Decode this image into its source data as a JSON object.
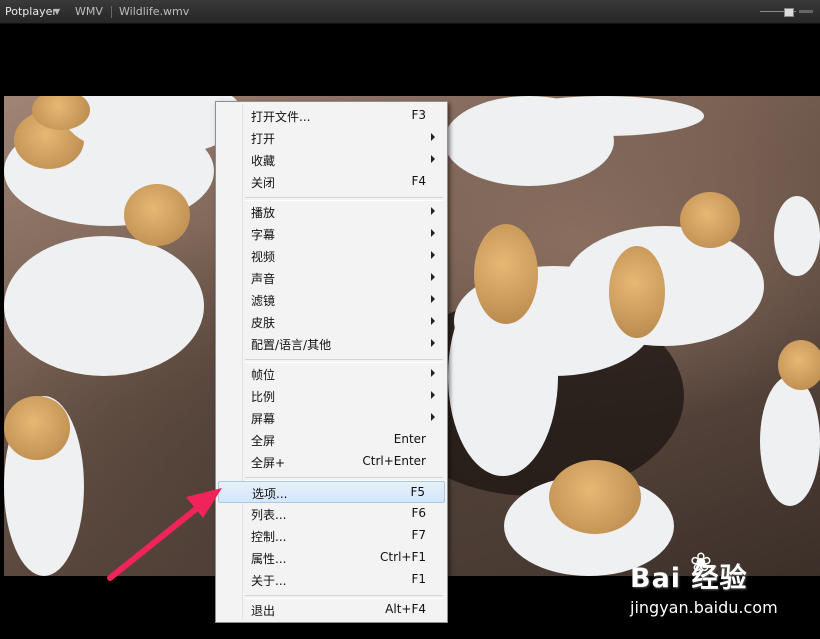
{
  "titlebar": {
    "app_label": "Potplayer",
    "format": "WMV",
    "filename": "Wildlife.wmv"
  },
  "menu": {
    "items": [
      {
        "label": "打开文件...",
        "key": "F3",
        "submenu": false
      },
      {
        "label": "打开",
        "key": "",
        "submenu": true
      },
      {
        "label": "收藏",
        "key": "",
        "submenu": true
      },
      {
        "label": "关闭",
        "key": "F4",
        "submenu": false
      },
      {
        "label": "播放",
        "key": "",
        "submenu": true
      },
      {
        "label": "字幕",
        "key": "",
        "submenu": true
      },
      {
        "label": "视频",
        "key": "",
        "submenu": true
      },
      {
        "label": "声音",
        "key": "",
        "submenu": true
      },
      {
        "label": "滤镜",
        "key": "",
        "submenu": true
      },
      {
        "label": "皮肤",
        "key": "",
        "submenu": true
      },
      {
        "label": "配置/语言/其他",
        "key": "",
        "submenu": true
      },
      {
        "label": "帧位",
        "key": "",
        "submenu": true
      },
      {
        "label": "比例",
        "key": "",
        "submenu": true
      },
      {
        "label": "屏幕",
        "key": "",
        "submenu": true
      },
      {
        "label": "全屏",
        "key": "Enter",
        "submenu": false
      },
      {
        "label": "全屏+",
        "key": "Ctrl+Enter",
        "submenu": false
      },
      {
        "label": "选项...",
        "key": "F5",
        "submenu": false,
        "highlighted": true
      },
      {
        "label": "列表...",
        "key": "F6",
        "submenu": false
      },
      {
        "label": "控制...",
        "key": "F7",
        "submenu": false
      },
      {
        "label": "属性...",
        "key": "Ctrl+F1",
        "submenu": false
      },
      {
        "label": "关于...",
        "key": "F1",
        "submenu": false
      },
      {
        "label": "退出",
        "key": "Alt+F4",
        "submenu": false
      }
    ]
  },
  "annotation": {
    "color": "#f0245a",
    "target": "选项..."
  },
  "watermark": {
    "brand": "Bai 经验",
    "url": "jingyan.baidu.com"
  }
}
